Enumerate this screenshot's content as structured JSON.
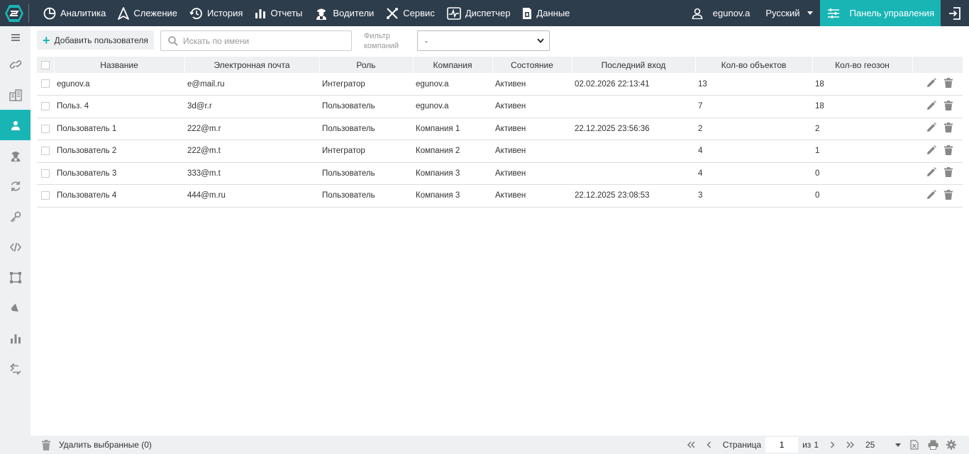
{
  "colors": {
    "topbar": "#2e3d4c",
    "accent": "#19b5b5",
    "sidebar": "#eef0f2"
  },
  "nav": {
    "items": [
      {
        "label": "Аналитика",
        "icon": "pie-chart-icon"
      },
      {
        "label": "Слежение",
        "icon": "navigation-arrow-icon"
      },
      {
        "label": "История",
        "icon": "history-clock-icon"
      },
      {
        "label": "Отчеты",
        "icon": "bar-chart-icon"
      },
      {
        "label": "Водители",
        "icon": "driver-icon"
      },
      {
        "label": "Сервис",
        "icon": "tools-icon"
      },
      {
        "label": "Диспетчер",
        "icon": "pulse-icon"
      },
      {
        "label": "Данные",
        "icon": "sim-card-icon"
      }
    ],
    "user": "egunov.a",
    "language": "Русский",
    "control_panel": "Панель управления"
  },
  "toolbar": {
    "add_user": "Добавить пользователя",
    "search_placeholder": "Искать по имени",
    "filter_label_1": "Фильтр",
    "filter_label_2": "компаний",
    "filter_value": "-"
  },
  "table": {
    "headers": [
      "Название",
      "Электронная почта",
      "Роль",
      "Компания",
      "Состояние",
      "Последний вход",
      "Кол-во объектов",
      "Кол-во геозон"
    ],
    "rows": [
      [
        "egunov.a",
        "e@mail.ru",
        "Интегратор",
        "egunov.a",
        "Активен",
        "02.02.2026 22:13:41",
        "13",
        "18"
      ],
      [
        "Польз. 4",
        "3d@r.r",
        "Пользователь",
        "egunov.a",
        "Активен",
        "",
        "7",
        "18"
      ],
      [
        "Пользователь 1",
        "222@m.r",
        "Пользователь",
        "Компания 1",
        "Активен",
        "22.12.2025 23:56:36",
        "2",
        "2"
      ],
      [
        "Пользователь 2",
        "222@m.t",
        "Интегратор",
        "Компания 2",
        "Активен",
        "",
        "4",
        "1"
      ],
      [
        "Пользователь 3",
        "333@m.t",
        "Пользователь",
        "Компания 3",
        "Активен",
        "",
        "4",
        "0"
      ],
      [
        "Пользователь 4",
        "444@m.ru",
        "Пользователь",
        "Компания 3",
        "Активен",
        "22.12.2025 23:08:53",
        "3",
        "0"
      ]
    ]
  },
  "footer": {
    "delete_selected": "Удалить выбранные (0)",
    "page_label": "Страница",
    "page_value": "1",
    "of_label": "из",
    "total_pages": "1",
    "page_size": "25"
  }
}
